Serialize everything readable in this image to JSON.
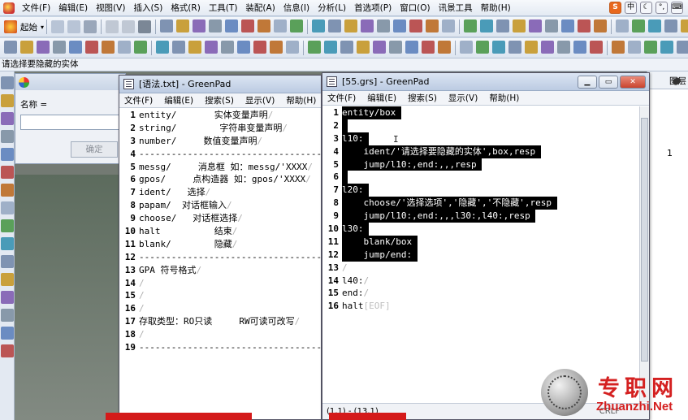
{
  "cad": {
    "menu": [
      "文件(F)",
      "编辑(E)",
      "视图(V)",
      "插入(S)",
      "格式(R)",
      "工具(T)",
      "装配(A)",
      "信息(I)",
      "分析(L)",
      "首选项(P)",
      "窗口(O)",
      "讯景工具",
      "帮助(H)"
    ],
    "toolbar_label": "起始",
    "prompt": "请选择要隐藏的实体",
    "right_panel_header": "图层",
    "right_panel_value": "1",
    "colors": {
      "canvas": "#737a73",
      "menubar": "#eef2f8"
    }
  },
  "hide_dialog": {
    "name_label": "名称  =",
    "ok_button": "确定"
  },
  "greenpad_left": {
    "title": "[语法.txt] - GreenPad",
    "menu": [
      "文件(F)",
      "编辑(E)",
      "搜索(S)",
      "显示(V)",
      "帮助(H)"
    ],
    "lines": [
      {
        "n": "1",
        "t": "entity/       实体变量声明"
      },
      {
        "n": "2",
        "t": "string/        字符串变量声明"
      },
      {
        "n": "3",
        "t": "number/     数值变量声明"
      },
      {
        "n": "4",
        "t": "---------------------------------------"
      },
      {
        "n": "5",
        "t": "messg/     消息框 如：messg/'XXXX"
      },
      {
        "n": "6",
        "t": "gpos/     点构造器 如：gpos/'XXXX"
      },
      {
        "n": "7",
        "t": "ident/   选择"
      },
      {
        "n": "8",
        "t": "papam/  对话框输入"
      },
      {
        "n": "9",
        "t": "choose/   对话框选择"
      },
      {
        "n": "10",
        "t": "halt          结束"
      },
      {
        "n": "11",
        "t": "blank/        隐藏"
      },
      {
        "n": "12",
        "t": "---------------------------------------"
      },
      {
        "n": "13",
        "t": "GPA 符号格式"
      },
      {
        "n": "14",
        "t": ""
      },
      {
        "n": "15",
        "t": ""
      },
      {
        "n": "16",
        "t": ""
      },
      {
        "n": "17",
        "t": "存取类型：RO只读     RW可读可改写"
      },
      {
        "n": "18",
        "t": ""
      },
      {
        "n": "19",
        "t": "---------------------------------------"
      }
    ]
  },
  "greenpad_right": {
    "title": "[55.grs] - GreenPad",
    "menu": [
      "文件(F)",
      "编辑(E)",
      "搜索(S)",
      "显示(V)",
      "帮助(H)"
    ],
    "lines": [
      {
        "n": "1",
        "t": "entity/box "
      },
      {
        "n": "2",
        "t": " "
      },
      {
        "n": "3",
        "t": "l10: "
      },
      {
        "n": "4",
        "t": "    ident/'请选择要隐藏的实体',box,resp "
      },
      {
        "n": "5",
        "t": "    jump/l10:,end:,,,resp "
      },
      {
        "n": "6",
        "t": " "
      },
      {
        "n": "7",
        "t": "l20: "
      },
      {
        "n": "8",
        "t": "    choose/'选择选项','隐藏','不隐藏',resp "
      },
      {
        "n": "9",
        "t": "    jump/l10:,end:,,,l30:,l40:,resp "
      },
      {
        "n": "10",
        "t": "l30: "
      },
      {
        "n": "11",
        "t": "    blank/box "
      },
      {
        "n": "12",
        "t": "    jump/end: "
      },
      {
        "n": "13",
        "t": ""
      },
      {
        "n": "14",
        "t": "l40:"
      },
      {
        "n": "15",
        "t": "end:"
      },
      {
        "n": "16",
        "t": "halt"
      }
    ],
    "selected_through_line": 12,
    "eof_marker": "[EOF]",
    "status": "(1,1) - (13,1)",
    "status_right": "CRLF",
    "cursor_glyph": "I"
  },
  "watermark": {
    "title": "专职网",
    "domain": "Zhuanzhi.Net",
    "color": "#d42020"
  }
}
